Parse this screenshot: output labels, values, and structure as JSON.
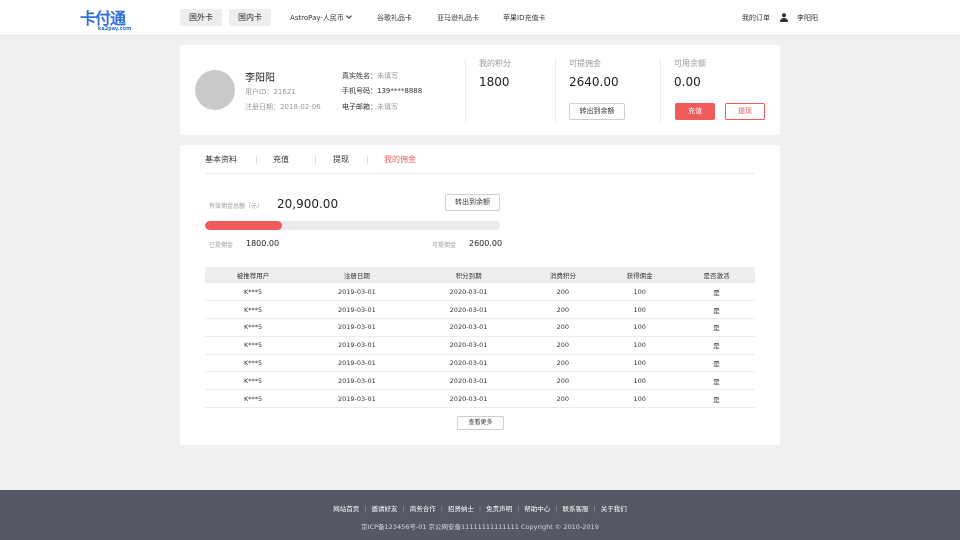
{
  "logo": {
    "text": "卡付通",
    "sub": "ka2pay.com"
  },
  "header": {
    "nav_buttons": [
      "国外卡",
      "国内卡"
    ],
    "nav_links": [
      "AstroPay-人民币",
      "谷歌礼品卡",
      "亚马逊礼品卡",
      "苹果ID充值卡"
    ],
    "my_orders": "我的订单",
    "username": "李阳阳"
  },
  "profile": {
    "name": "李阳阳",
    "user_id": "用户ID：21621",
    "register_date": "注册日期：2018-02-06",
    "real_name_label": "真实姓名：",
    "real_name_value": "未填写",
    "phone_label": "手机号码：",
    "phone_value": "139****8888",
    "email_label": "电子邮箱：",
    "email_value": "未填写"
  },
  "stats": {
    "points_label": "我的积分",
    "points_value": "1800",
    "commission_label": "可提佣金",
    "commission_value": "2640.00",
    "transfer_button": "转出到余额",
    "balance_label": "可用余额",
    "balance_value": "0.00",
    "recharge_button": "充值",
    "withdraw_button": "提现"
  },
  "tabs": [
    "基本资料",
    "充值",
    "提现",
    "我的佣金"
  ],
  "active_tab": 3,
  "commission": {
    "total_label": "有效佣金总额（元）",
    "total_value": "20,900.00",
    "transfer_button": "转出到余额",
    "withdrawn_label": "已提佣金",
    "withdrawn_value": "1800.00",
    "available_label": "可提佣金",
    "available_value": "2600.00",
    "progress_fraction": 0.26
  },
  "table": {
    "headers": [
      "被推荐用户",
      "注册日期",
      "积分到期",
      "消费积分",
      "获得佣金",
      "是否激活"
    ],
    "rows": [
      [
        "K***5",
        "2019-03-01",
        "2020-03-01",
        "200",
        "100",
        "是"
      ],
      [
        "K***5",
        "2019-03-01",
        "2020-03-01",
        "200",
        "100",
        "是"
      ],
      [
        "K***5",
        "2019-03-01",
        "2020-03-01",
        "200",
        "100",
        "是"
      ],
      [
        "K***5",
        "2019-03-01",
        "2020-03-01",
        "200",
        "100",
        "是"
      ],
      [
        "K***5",
        "2019-03-01",
        "2020-03-01",
        "200",
        "100",
        "是"
      ],
      [
        "K***5",
        "2019-03-01",
        "2020-03-01",
        "200",
        "100",
        "是"
      ],
      [
        "K***5",
        "2019-03-01",
        "2020-03-01",
        "200",
        "100",
        "是"
      ]
    ],
    "more_button": "查看更多"
  },
  "footer": {
    "links": [
      "网站首页",
      "邀请好友",
      "商务合作",
      "招贤纳士",
      "免责声明",
      "帮助中心",
      "联系客服",
      "关于我们"
    ],
    "copyright": "京ICP备123456号-01   京公网安备11111111111111   Copyright  ©  2010-2019"
  },
  "colors": {
    "accent": "#ef5b5b",
    "brand": "#2f6fd6",
    "footer_bg": "#555865"
  }
}
